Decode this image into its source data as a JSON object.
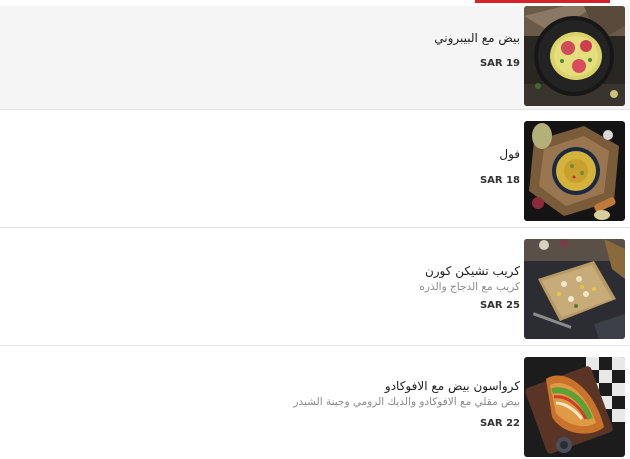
{
  "colors": {
    "accent": "#d6232a"
  },
  "menu": {
    "items": [
      {
        "name": "بيض مع البيبروني",
        "description": "",
        "price": "SAR 19",
        "image": "pepperoni-omelette-image"
      },
      {
        "name": "فول",
        "description": "",
        "price": "SAR 18",
        "image": "foul-bowl-image"
      },
      {
        "name": "كريب تشيكن كورن",
        "description": "كريب مع الدجاج والذره",
        "price": "SAR 25",
        "image": "chicken-corn-crepe-image"
      },
      {
        "name": "كرواسون بيض مع الافوكادو",
        "description": "بيض مقلي مع الافوكادو والديك الرومي وجبنة الشيدر",
        "price": "SAR 22",
        "image": "avocado-egg-croissant-image"
      }
    ]
  }
}
